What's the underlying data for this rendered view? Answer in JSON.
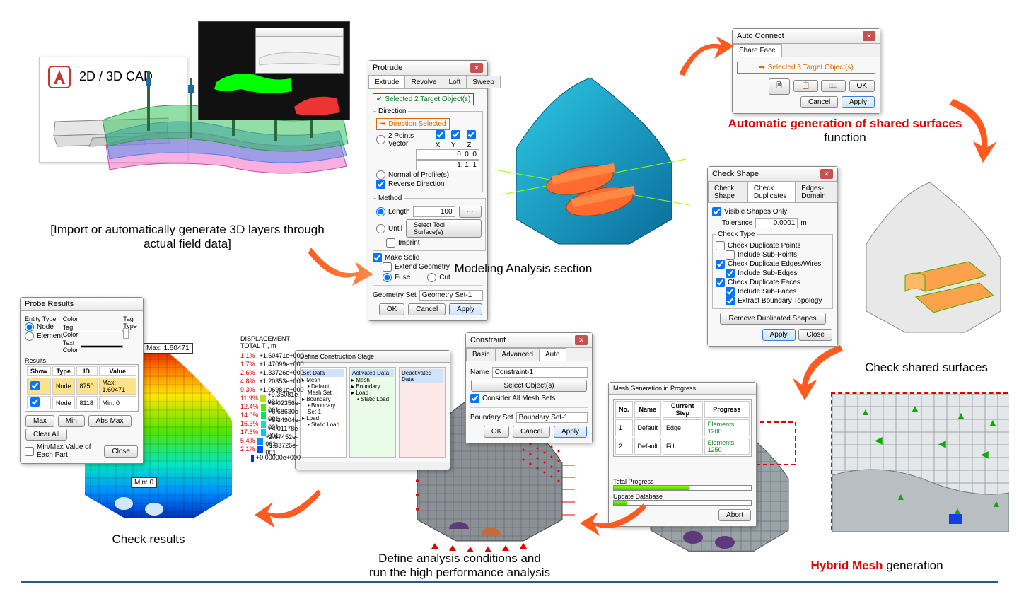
{
  "steps": {
    "import": "[Import or automatically generate 3D layers through actual field data]",
    "modeling": "Modeling Analysis section",
    "auto_gen_red": "Automatic generation of shared surfaces",
    "auto_gen_rest": " function",
    "check_shared": "Check shared surfaces",
    "hybrid_red": "Hybrid Mesh",
    "hybrid_rest": " generation",
    "define": "Define analysis conditions and\nrun the high performance analysis",
    "check_results": "Check results"
  },
  "cad_panel": {
    "title": "2D / 3D\nCAD"
  },
  "protrude": {
    "title": "Protrude",
    "tabs": [
      "Extrude",
      "Revolve",
      "Loft",
      "Sweep"
    ],
    "sel_targets": "Selected 2 Target Object(s)",
    "direction_label": "Direction",
    "direction_sel": "Direction Selected",
    "two_points": "2 Points Vector",
    "axes": [
      "X",
      "Y",
      "Z"
    ],
    "vec1": "0, 0, 0",
    "vec2": "1, 1, 1",
    "normal": "Normal of Profile(s)",
    "reverse": "Reverse Direction",
    "method_label": "Method",
    "method_length": "Length",
    "method_until": "Until",
    "length_val": "100",
    "select_tool": "Select Tool Surface(s)",
    "make_solid": "Make Solid",
    "extend": "Extend Geometry",
    "fuse": "Fuse",
    "cut": "Cut",
    "imprint": "Imprint",
    "geom_set_label": "Geometry Set",
    "geom_set_val": "Geometry Set-1",
    "ok": "OK",
    "cancel": "Cancel",
    "apply": "Apply"
  },
  "autoconnect": {
    "title": "Auto Connect",
    "tab": "Share Face",
    "sel": "Selected 3 Target Object(s)",
    "ok": "OK",
    "cancel": "Cancel",
    "apply": "Apply"
  },
  "checkshape": {
    "title": "Check Shape",
    "tabs": [
      "Check Shape",
      "Check Duplicates",
      "Edges-Domain"
    ],
    "visible": "Visible Shapes Only",
    "tol_label": "Tolerance",
    "tol_val": "0.0001",
    "tol_unit": "m",
    "ctype": "Check Type",
    "dup_pts": "Check Duplicate Points",
    "inc_subpts": "Include Sub-Points",
    "dup_edges": "Check Duplicate Edges/Wires",
    "inc_subedges": "Include Sub-Edges",
    "dup_faces": "Check Duplicate Faces",
    "inc_subfaces": "Include Sub-Faces",
    "extract": "Extract Boundary Topology",
    "remove": "Remove Duplicated Shapes",
    "apply": "Apply",
    "close": "Close"
  },
  "constraint": {
    "title": "Constraint",
    "tabs": [
      "Basic",
      "Advanced",
      "Auto"
    ],
    "name_label": "Name",
    "name_val": "Constraint-1",
    "sel": "Select Object(s)",
    "consider": "Consider All Mesh Sets",
    "bset_label": "Boundary Set",
    "bset_val": "Boundary Set-1",
    "ok": "OK",
    "cancel": "Cancel",
    "apply": "Apply"
  },
  "meshgen": {
    "title": "Mesh Generation in Progress",
    "cols": [
      "No.",
      "Name",
      "Current Step",
      "Progress"
    ],
    "rows": [
      {
        "no": "1",
        "name": "Default",
        "step": "Edge",
        "prog": "Elements: 1200"
      },
      {
        "no": "2",
        "name": "Default",
        "step": "Fill",
        "prog": "Elements: 1250"
      }
    ],
    "total": "Total Progress",
    "update": "Update Database",
    "abort": "Abort"
  },
  "probe": {
    "title": "Probe Results",
    "entity": "Entity Type",
    "node": "Node",
    "element": "Element",
    "color": "Color",
    "tagcolor": "Tag Color",
    "textcolor": "Text Color",
    "tagtype": "Tag Type",
    "results": "Results",
    "cols": [
      "Show",
      "Type",
      "ID",
      "Value"
    ],
    "r1_type": "Node",
    "r1_id": "8750",
    "r1_val": "Max: 1.60471",
    "r2_type": "Node",
    "r2_id": "8118",
    "r2_val": "Min: 0",
    "max_btn": "Max",
    "min_btn": "Min",
    "absmax": "Abs Max",
    "clearall": "Clear All",
    "mmeach": "Min/Max Value of Each Part",
    "close": "Close"
  },
  "max_tag": "Max: 1.60471",
  "min_tag": "Min: 0",
  "legend": {
    "title": "DISPLACEMENT\nTOTAL T , m",
    "items": [
      {
        "pct": "1.1%",
        "val": "+1.60471e+000"
      },
      {
        "pct": "1.7%",
        "val": "+1.47099e+000"
      },
      {
        "pct": "2.6%",
        "val": "+1.33726e+000"
      },
      {
        "pct": "4.8%",
        "val": "+1.20353e+000"
      },
      {
        "pct": "9.3%",
        "val": "+1.06981e+000"
      },
      {
        "pct": "11.9%",
        "val": "+9.36081e-001"
      },
      {
        "pct": "12.4%",
        "val": "+8.02356e-001"
      },
      {
        "pct": "14.0%",
        "val": "+6.68630e-001"
      },
      {
        "pct": "16.3%",
        "val": "+5.34904e-001"
      },
      {
        "pct": "17.6%",
        "val": "+4.01178e-001"
      },
      {
        "pct": "5.4%",
        "val": "+2.67452e-001"
      },
      {
        "pct": "2.1%",
        "val": "+1.33726e-001"
      },
      {
        "pct": "",
        "val": "+0.00000e+000"
      }
    ]
  },
  "arrow_icon": "➜"
}
